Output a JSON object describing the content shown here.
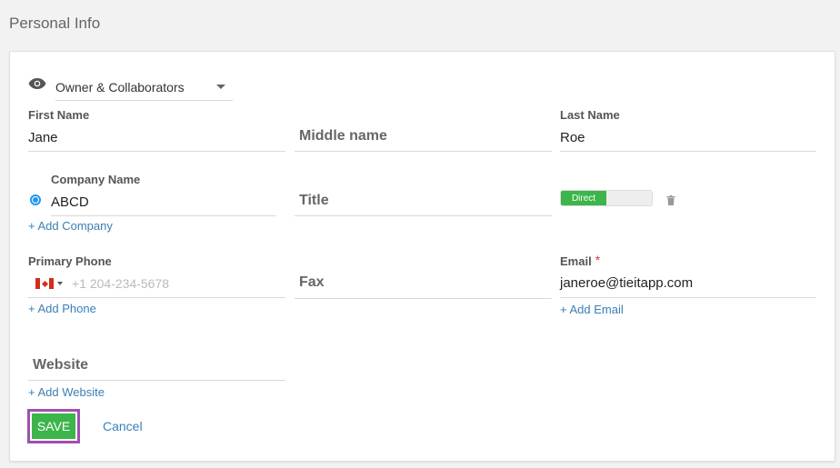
{
  "page": {
    "title": "Personal Info"
  },
  "visibility": {
    "selected": "Owner & Collaborators"
  },
  "fields": {
    "first_name": {
      "label": "First Name",
      "value": "Jane"
    },
    "middle_name": {
      "placeholder": "Middle name"
    },
    "last_name": {
      "label": "Last Name",
      "value": "Roe"
    },
    "company": {
      "label": "Company Name",
      "value": "ABCD",
      "add_link": "+ Add Company"
    },
    "title": {
      "placeholder": "Title"
    },
    "relationship": {
      "toggle_label": "Direct"
    },
    "primary_phone": {
      "label": "Primary Phone",
      "placeholder": "+1 204-234-5678",
      "add_link": "+ Add Phone"
    },
    "fax": {
      "placeholder": "Fax"
    },
    "email": {
      "label": "Email",
      "required_mark": "*",
      "value": "janeroe@tieitapp.com",
      "add_link": "+ Add Email"
    },
    "website": {
      "placeholder": "Website",
      "add_link": "+ Add Website"
    }
  },
  "actions": {
    "save": "SAVE",
    "cancel": "Cancel"
  },
  "colors": {
    "accent_green": "#3cb54a",
    "link_blue": "#3a7fb5",
    "focus_purple": "#a04fb0",
    "required_red": "#e53935"
  }
}
